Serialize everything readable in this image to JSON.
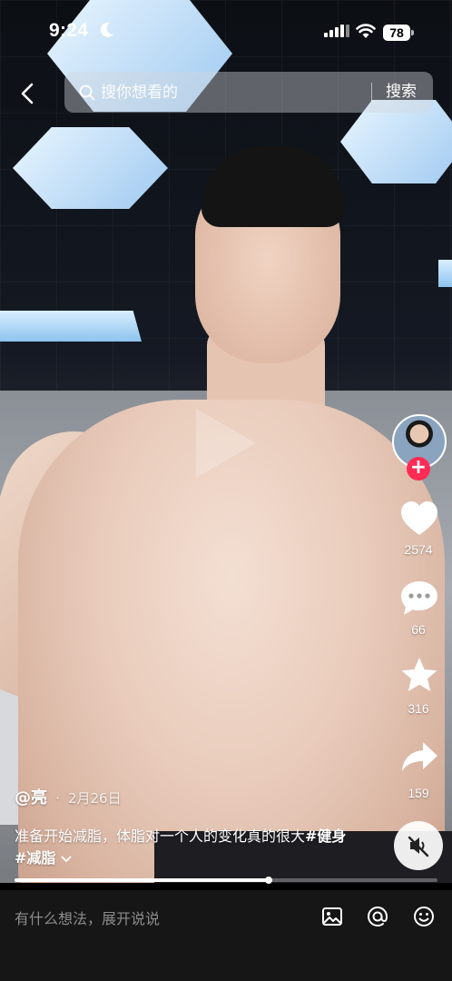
{
  "status_bar": {
    "time": "9:24",
    "battery": "78"
  },
  "search": {
    "placeholder": "搜你想看的",
    "button_label": "搜索"
  },
  "post": {
    "author": "@亮",
    "date": "2月26日",
    "description": "准备开始减脂，体脂对一个人的变化真的很大",
    "hashtags": [
      "#健身",
      "#减脂"
    ],
    "progress": 0.6
  },
  "actions": {
    "likes": "2574",
    "comments": "66",
    "favorites": "316",
    "shares": "159"
  },
  "comment_bar": {
    "placeholder": "有什么想法，展开说说"
  },
  "colors": {
    "follow_accent": "#fe2c55",
    "comment_bar_bg": "#161616"
  }
}
